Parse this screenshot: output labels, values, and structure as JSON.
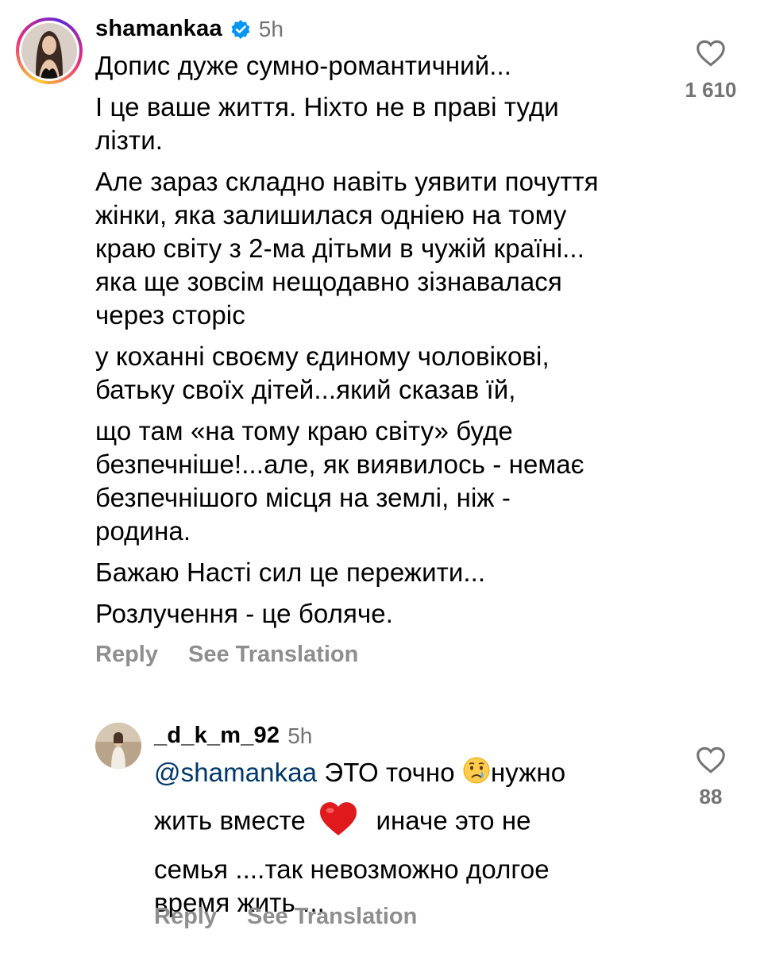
{
  "main_comment": {
    "username": "shamankaa",
    "time": "5h",
    "verified": true,
    "paragraphs": [
      [
        "Допис дуже сумно-романтичний..."
      ],
      [
        "І це ваше життя. Ніхто не в праві туди",
        "лізти."
      ],
      [
        "Але зараз складно навіть уявити почуття",
        "жінки, яка залишилася одніею на тому",
        "краю світу з 2-ма дітьми в чужій країні...",
        "яка ще зовсім нещодавно зізнавалася",
        "через сторіс"
      ],
      [
        "у коханні своєму єдиному чоловікові,",
        "батьку своїх дітей...який сказав їй,"
      ],
      [
        "що там «на тому краю світу» буде",
        "безпечніше!...але, як виявилось - немає",
        "безпечнішого місця на землі, ніж -",
        "родина."
      ],
      [
        "Бажаю Насті сил це пережити..."
      ],
      [
        "Розлучення - це боляче."
      ]
    ],
    "actions": {
      "reply": "Reply",
      "see_translation": "See Translation"
    },
    "likes": "1 610"
  },
  "reply_comment": {
    "username": "_d_k_m_92",
    "time": "5h",
    "mention": "@shamankaa",
    "line1_text": " ЭТО точно",
    "line1_after_emoji": "нужно",
    "line2_before_emoji": "жить вместе",
    "line2_after_emoji": "иначе это не",
    "line3": "семья ....так невозможно долгое",
    "line4": "время жить ...",
    "emojis": [
      "crying-face",
      "red-heart"
    ],
    "actions": {
      "reply": "Reply",
      "see_translation": "See Translation"
    },
    "likes": "88"
  },
  "colors": {
    "secondary_text": "#737373",
    "action_text": "#8e8e8e",
    "mention": "#00376b",
    "verified": "#0095f6",
    "heart_outline": "#737373"
  }
}
